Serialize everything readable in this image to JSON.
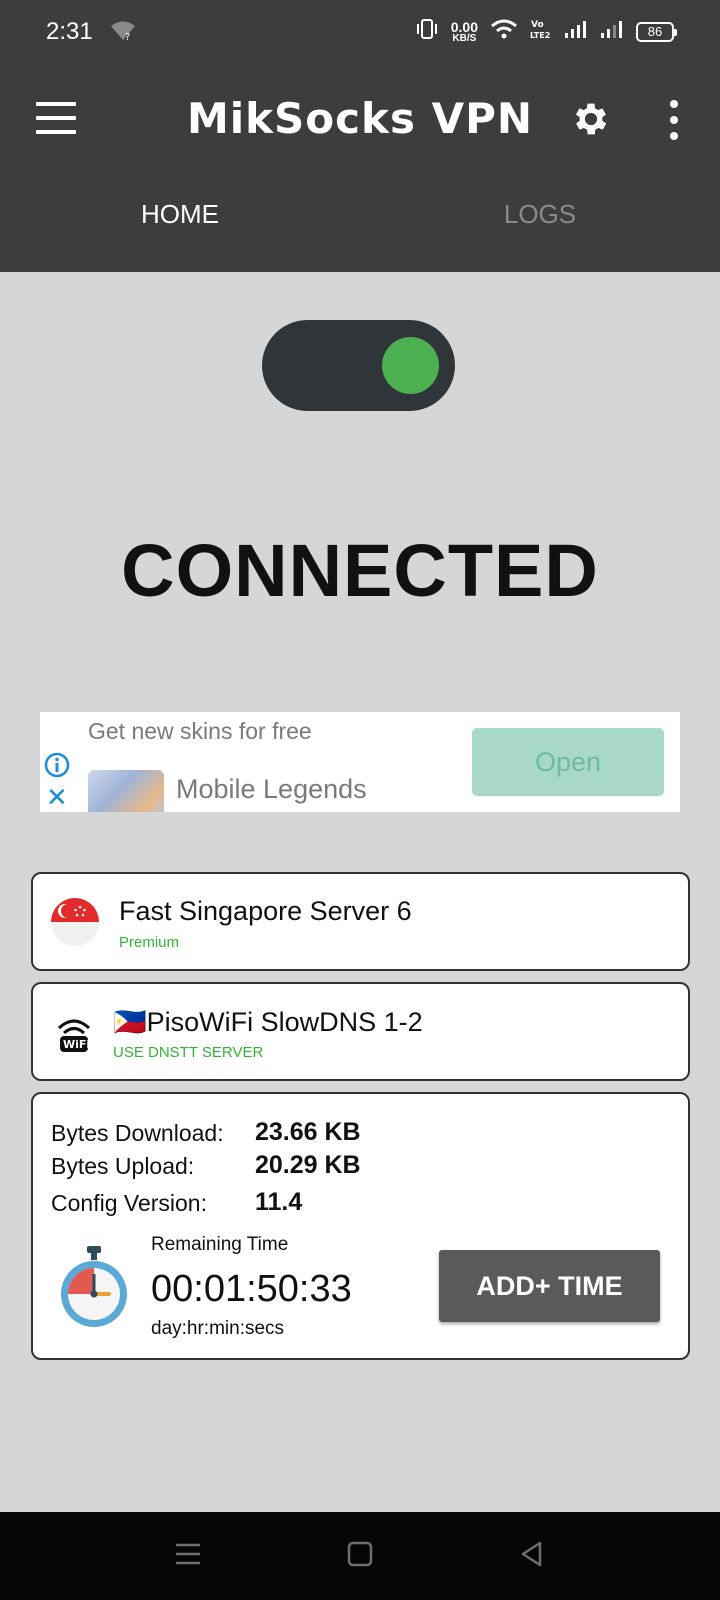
{
  "status_bar": {
    "time": "2:31",
    "net_speed_value": "0.00",
    "net_speed_unit": "KB/S",
    "battery": "86"
  },
  "app": {
    "title": "MikSocks VPN"
  },
  "tabs": [
    {
      "label": "HOME",
      "active": true
    },
    {
      "label": "LOGS",
      "active": false
    }
  ],
  "connection": {
    "toggle_on": true,
    "status": "CONNECTED",
    "toggle_color": "#4caf50"
  },
  "ad": {
    "headline": "Get new skins for free",
    "app_name": "Mobile Legends",
    "cta": "Open"
  },
  "server": {
    "name": "Fast Singapore Server 6",
    "tier": "Premium"
  },
  "dns": {
    "flag_emoji": "🇵🇭",
    "name": "PisoWiFi SlowDNS 1-2",
    "mode": "USE DNSTT SERVER"
  },
  "stats": {
    "download_label": "Bytes Download:",
    "download_value": "23.66 KB",
    "upload_label": "Bytes Upload:",
    "upload_value": "20.29 KB",
    "config_label": "Config Version:",
    "config_value": "11.4",
    "remaining_label": "Remaining Time",
    "remaining_value": "00:01:50:33",
    "remaining_unit": "day:hr:min:secs",
    "add_time_label": "ADD+ TIME"
  },
  "colors": {
    "appbar": "#3d3d3d",
    "background": "#d6d6d6",
    "accent_green": "#32b432"
  }
}
